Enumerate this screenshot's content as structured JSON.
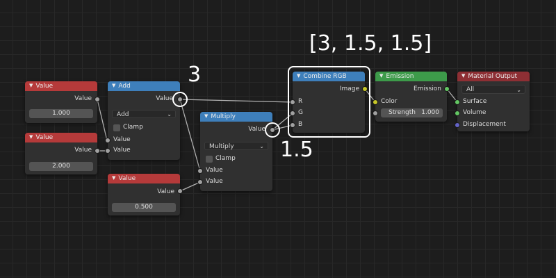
{
  "nodes": {
    "value1": {
      "title": "Value",
      "output_label": "Value",
      "field": "1.000"
    },
    "value2": {
      "title": "Value",
      "output_label": "Value",
      "field": "2.000"
    },
    "value3": {
      "title": "Value",
      "output_label": "Value",
      "field": "0.500"
    },
    "add": {
      "title": "Add",
      "output_label": "Value",
      "operation": "Add",
      "clamp_label": "Clamp",
      "input1_label": "Value",
      "input2_label": "Value"
    },
    "multiply": {
      "title": "Multiply",
      "output_label": "Value",
      "operation": "Multiply",
      "clamp_label": "Clamp",
      "input1_label": "Value",
      "input2_label": "Value"
    },
    "combine_rgb": {
      "title": "Combine RGB",
      "output_label": "Image",
      "inputs": [
        "R",
        "G",
        "B"
      ]
    },
    "emission": {
      "title": "Emission",
      "output_label": "Emission",
      "color_label": "Color",
      "strength_label": "Strength",
      "strength_value": "1.000"
    },
    "material_output": {
      "title": "Material Output",
      "target": "All",
      "inputs": [
        "Surface",
        "Volume",
        "Displacement"
      ]
    }
  },
  "annotations": {
    "add_result": "3",
    "multiply_result": "1.5",
    "rgb_result": "[3, 1.5, 1.5]"
  },
  "colors": {
    "value_header": "#b53a3a",
    "converter_header": "#3e7fbb",
    "shader_header": "#3d9b4a",
    "output_header": "#8e2f34",
    "socket_float": "#a1a1a1",
    "socket_color": "#c7c729",
    "socket_shader": "#63c763",
    "socket_vector": "#6363c7"
  },
  "icons": {
    "collapse": "triangle-down-icon",
    "dropdown": "chevron-down-icon"
  }
}
